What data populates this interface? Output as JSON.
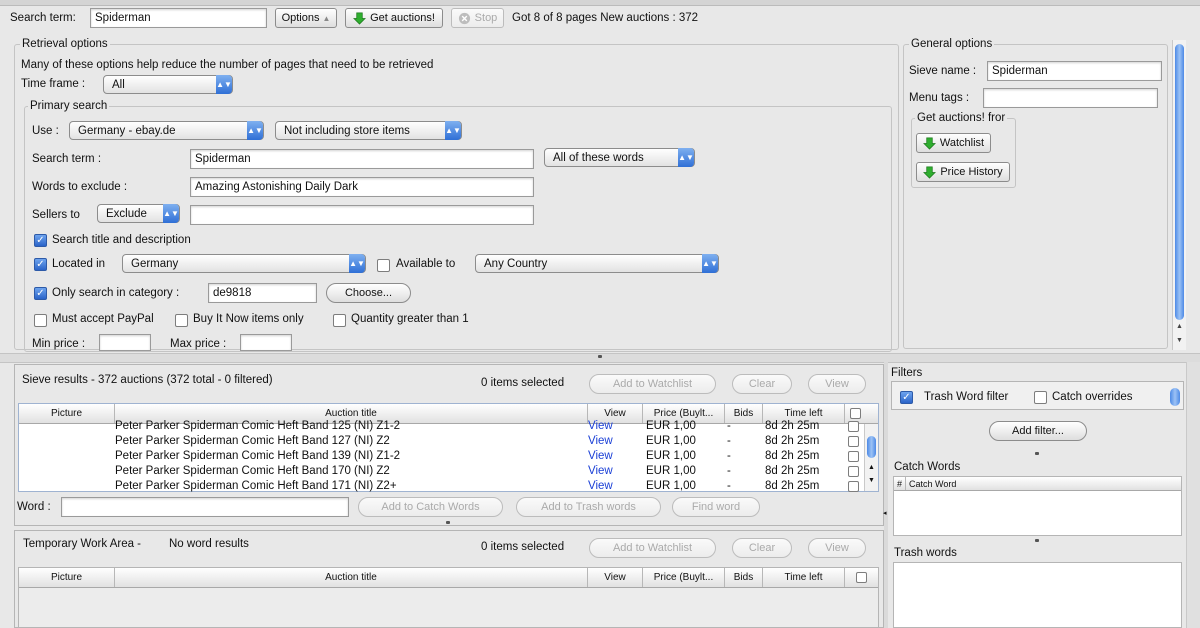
{
  "topbar": {
    "search_label": "Search term:",
    "search_value": "Spiderman",
    "options_label": "Options",
    "get_auctions_label": "Get auctions!",
    "stop_label": "Stop",
    "status_text": "Got 8 of 8 pages New auctions : 372"
  },
  "retrieval": {
    "title": "Retrieval options",
    "description": "Many of these options help reduce the number of pages that need to be retrieved",
    "timeframe_label": "Time frame :",
    "timeframe_value": "All",
    "primary": {
      "title": "Primary search",
      "use_label": "Use :",
      "site_value": "Germany - ebay.de",
      "store_value": "Not including store items",
      "search_term_label": "Search term :",
      "search_term_value": "Spiderman",
      "words_mode_value": "All of these words",
      "exclude_label": "Words to exclude :",
      "exclude_value": "Amazing Astonishing Daily Dark",
      "sellers_label": "Sellers to",
      "sellers_mode_value": "Exclude",
      "sellers_value": "",
      "search_title_desc_label": "Search title and description",
      "located_label": "Located in",
      "located_value": "Germany",
      "available_label": "Available to",
      "available_value": "Any Country",
      "category_label": "Only search in category :",
      "category_value": "de9818",
      "choose_label": "Choose...",
      "paypal_label": "Must accept PayPal",
      "bin_label": "Buy It Now items only",
      "qty_label": "Quantity greater than 1",
      "min_price_label": "Min price :",
      "max_price_label": "Max price :"
    }
  },
  "general": {
    "title": "General options",
    "sieve_name_label": "Sieve name :",
    "sieve_name_value": "Spiderman",
    "menu_tags_label": "Menu tags :",
    "menu_tags_value": "",
    "get_from_title": "Get auctions! fror",
    "watchlist_label": "Watchlist",
    "price_history_label": "Price History"
  },
  "sieve_results": {
    "title": "Sieve results - 372 auctions (372 total - 0 filtered)",
    "selected_text": "0 items selected",
    "add_watchlist_label": "Add to Watchlist",
    "clear_label": "Clear",
    "view_label": "View",
    "columns": [
      "Picture",
      "Auction title",
      "View",
      "Price (Buylt...",
      "Bids",
      "Time left"
    ],
    "rows": [
      {
        "title": "Peter Parker Spiderman Comic Heft Band 125 (NI) Z1-2",
        "view": "View",
        "price": "EUR 1,00",
        "bids": "-",
        "time": "8d 2h 25m"
      },
      {
        "title": "Peter Parker Spiderman Comic Heft Band 127 (NI) Z2",
        "view": "View",
        "price": "EUR 1,00",
        "bids": "-",
        "time": "8d 2h 25m"
      },
      {
        "title": "Peter Parker Spiderman Comic Heft Band 139 (NI) Z1-2",
        "view": "View",
        "price": "EUR 1,00",
        "bids": "-",
        "time": "8d 2h 25m"
      },
      {
        "title": "Peter Parker Spiderman Comic Heft Band 170 (NI) Z2",
        "view": "View",
        "price": "EUR 1,00",
        "bids": "-",
        "time": "8d 2h 25m"
      },
      {
        "title": "Peter Parker Spiderman Comic Heft Band 171 (NI) Z2+",
        "view": "View",
        "price": "EUR 1,00",
        "bids": "-",
        "time": "8d 2h 25m"
      }
    ],
    "word_label": "Word :",
    "word_value": "",
    "add_catch_label": "Add to Catch Words",
    "add_trash_label": "Add to Trash words",
    "find_word_label": "Find word"
  },
  "temp_area": {
    "title": "Temporary Work Area -",
    "no_results": "No word results",
    "selected_text": "0 items selected",
    "add_watchlist_label": "Add to Watchlist",
    "clear_label": "Clear",
    "view_label": "View",
    "columns": [
      "Picture",
      "Auction title",
      "View",
      "Price (Buylt...",
      "Bids",
      "Time left"
    ]
  },
  "filters": {
    "title": "Filters",
    "trash_filter_label": "Trash Word filter",
    "catch_overrides_label": "Catch overrides",
    "add_filter_label": "Add filter...",
    "catch_words_title": "Catch Words",
    "catch_col_hash": "#",
    "catch_col_word": "Catch Word",
    "trash_words_title": "Trash words"
  },
  "colors": {
    "accent": "#2f6fd6",
    "link": "#1a3fd6",
    "get_icon": "#2fae2f"
  }
}
